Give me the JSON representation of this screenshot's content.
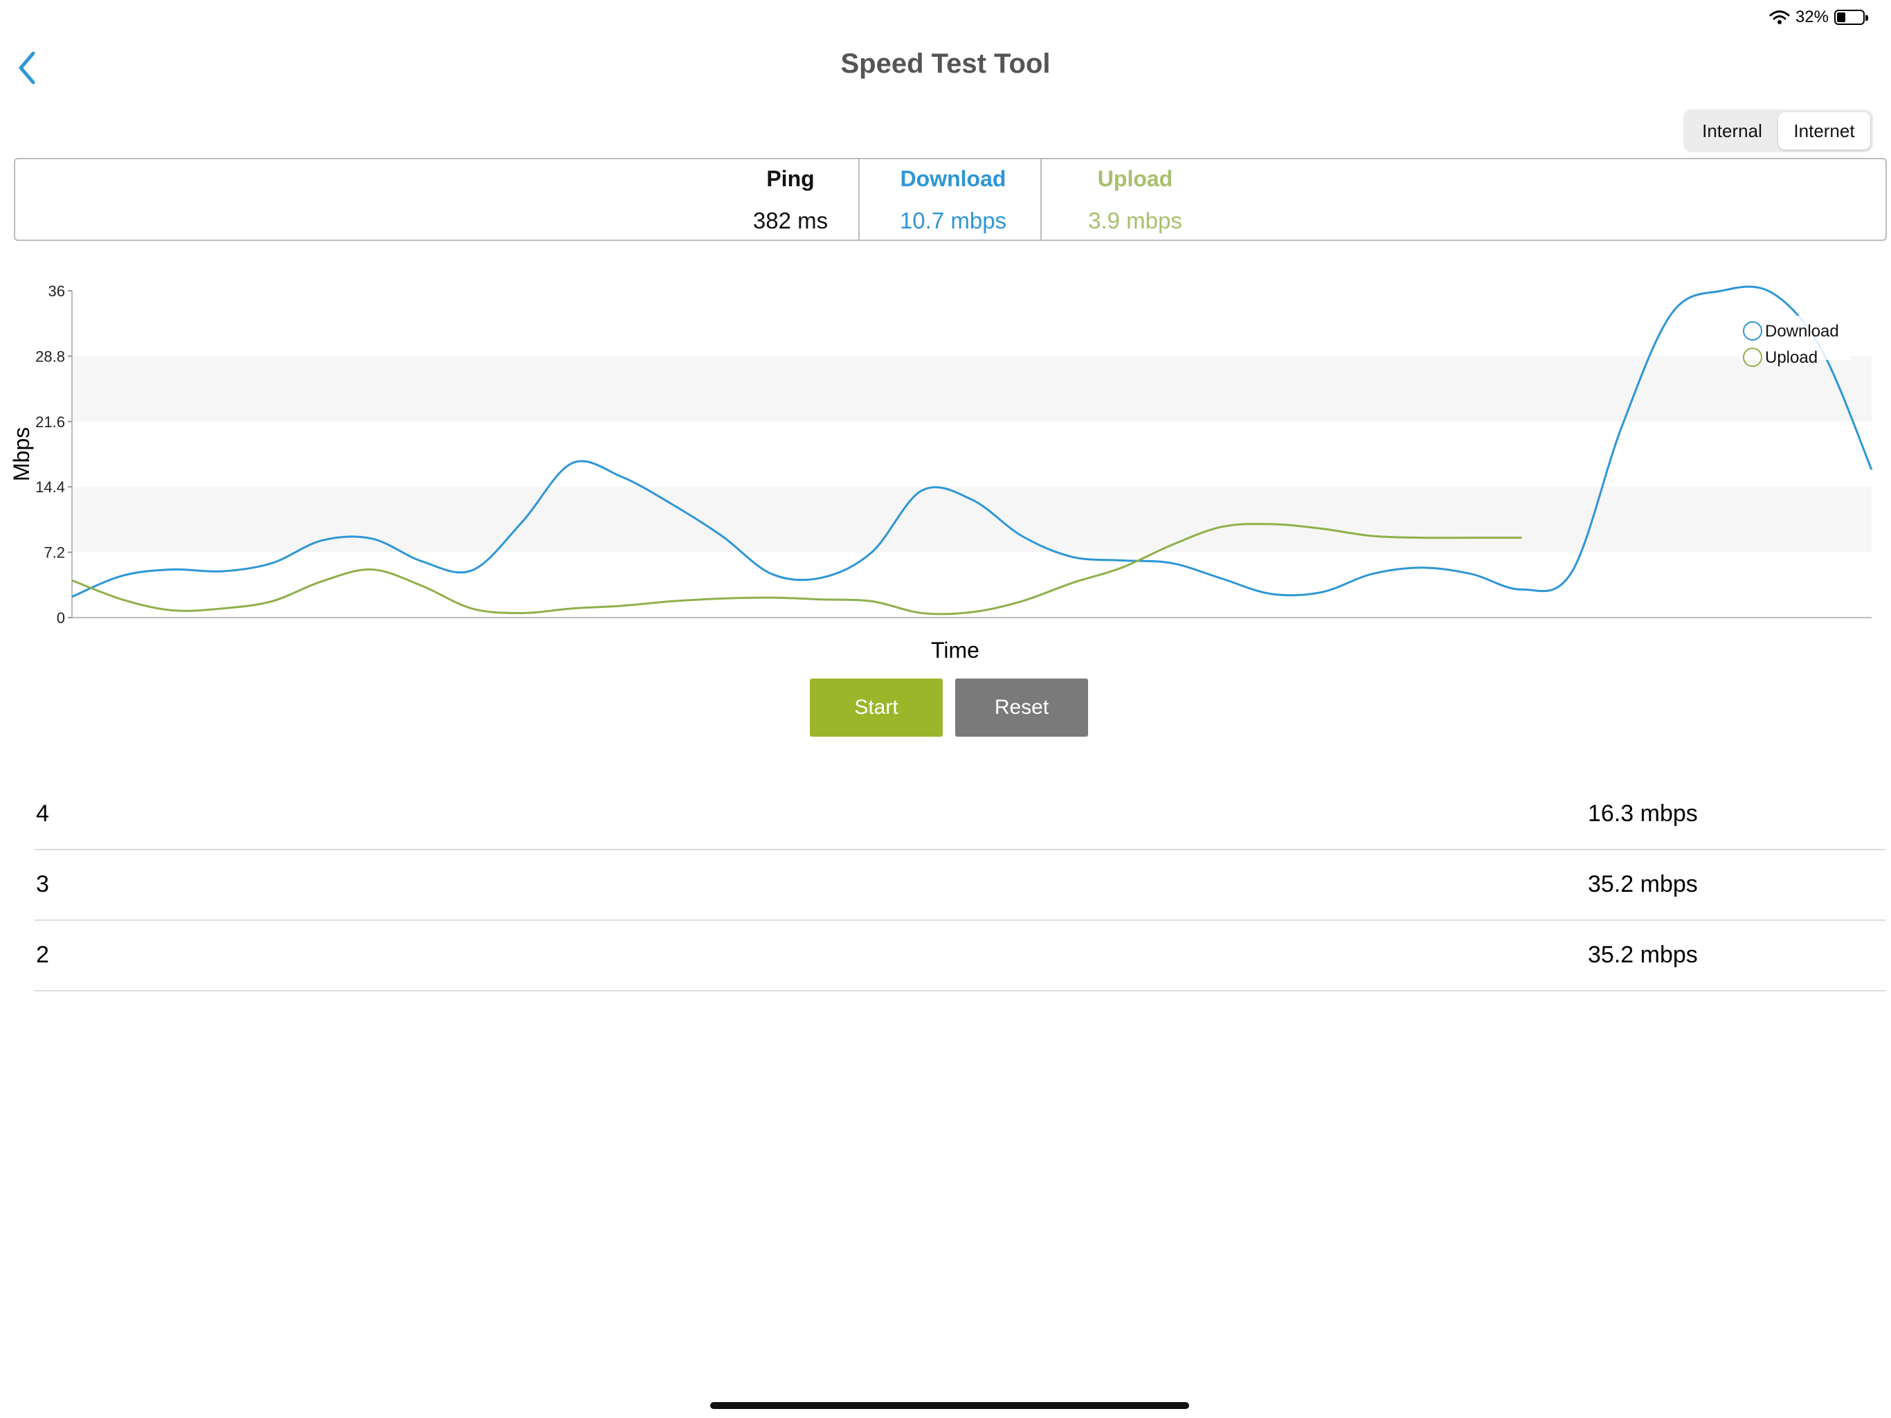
{
  "status_bar": {
    "battery_text": "32%",
    "battery_level": 0.32
  },
  "header": {
    "title": "Speed Test Tool",
    "back_icon": "chevron-left-icon"
  },
  "segmented_control": {
    "options": [
      "Internal",
      "Internet"
    ],
    "selected": "Internet"
  },
  "summary": {
    "ping": {
      "label": "Ping",
      "value": "382 ms"
    },
    "download": {
      "label": "Download",
      "value": "10.7 mbps"
    },
    "upload": {
      "label": "Upload",
      "value": "3.9 mbps"
    }
  },
  "colors": {
    "download": "#2e96d6",
    "upload": "#8fb04a",
    "start": "#9bb62a",
    "reset": "#7a7a7a",
    "title": "#555555"
  },
  "chart_data": {
    "type": "line",
    "xlabel": "Time",
    "ylabel": "Mbps",
    "ylim": [
      0,
      36
    ],
    "yticks": [
      "0",
      "7.2",
      "14.4",
      "21.6",
      "28.8",
      "36"
    ],
    "grid": "alternating horizontal bands",
    "legend": {
      "position": "top-right",
      "entries": [
        "Download",
        "Upload"
      ]
    },
    "series": [
      {
        "name": "Download",
        "values": [
          2.3,
          4.6,
          5.3,
          5.1,
          6.0,
          8.5,
          8.7,
          6.2,
          5.2,
          10.5,
          17.0,
          15.5,
          12.5,
          9.0,
          4.8,
          4.4,
          7.2,
          14.0,
          13.0,
          9.0,
          6.7,
          6.3,
          6.0,
          4.3,
          2.6,
          2.8,
          4.8,
          5.5,
          4.8,
          3.1,
          5.0,
          21.0,
          33.5,
          36.0,
          35.8,
          29.5,
          16.3
        ]
      },
      {
        "name": "Upload",
        "values": [
          4.1,
          2.0,
          0.8,
          1.0,
          1.8,
          4.0,
          5.3,
          3.5,
          1.0,
          0.5,
          1.0,
          1.3,
          1.8,
          2.1,
          2.2,
          2.0,
          1.8,
          0.5,
          0.6,
          1.8,
          3.8,
          5.5,
          8.0,
          10.0,
          10.3,
          9.8,
          9.0,
          8.8,
          8.8,
          8.8
        ]
      }
    ]
  },
  "buttons": {
    "start": "Start",
    "reset": "Reset"
  },
  "results": [
    {
      "index": "4",
      "value": "16.3 mbps"
    },
    {
      "index": "3",
      "value": "35.2 mbps"
    },
    {
      "index": "2",
      "value": "35.2 mbps"
    }
  ]
}
